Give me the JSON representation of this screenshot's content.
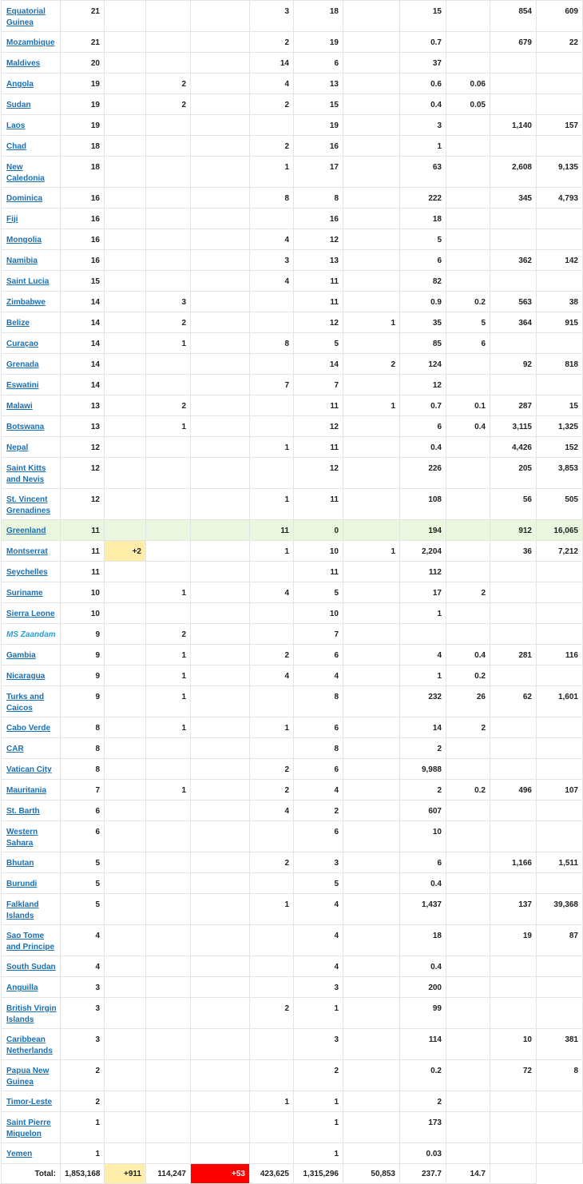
{
  "rows": [
    {
      "name": "Equatorial Guinea",
      "c": [
        "21",
        "",
        "",
        "3",
        "18",
        "",
        "15",
        "",
        "854",
        "609"
      ]
    },
    {
      "name": "Mozambique",
      "c": [
        "21",
        "",
        "",
        "2",
        "19",
        "",
        "0.7",
        "",
        "679",
        "22"
      ]
    },
    {
      "name": "Maldives",
      "c": [
        "20",
        "",
        "",
        "14",
        "6",
        "",
        "37",
        "",
        "",
        ""
      ]
    },
    {
      "name": "Angola",
      "c": [
        "19",
        "",
        "2",
        "4",
        "13",
        "",
        "0.6",
        "0.06",
        "",
        ""
      ]
    },
    {
      "name": "Sudan",
      "c": [
        "19",
        "",
        "2",
        "2",
        "15",
        "",
        "0.4",
        "0.05",
        "",
        ""
      ]
    },
    {
      "name": "Laos",
      "c": [
        "19",
        "",
        "",
        "",
        "19",
        "",
        "3",
        "",
        "1,140",
        "157"
      ]
    },
    {
      "name": "Chad",
      "c": [
        "18",
        "",
        "",
        "2",
        "16",
        "",
        "1",
        "",
        "",
        ""
      ]
    },
    {
      "name": "New Caledonia",
      "c": [
        "18",
        "",
        "",
        "1",
        "17",
        "",
        "63",
        "",
        "2,608",
        "9,135"
      ]
    },
    {
      "name": "Dominica",
      "c": [
        "16",
        "",
        "",
        "8",
        "8",
        "",
        "222",
        "",
        "345",
        "4,793"
      ]
    },
    {
      "name": "Fiji",
      "c": [
        "16",
        "",
        "",
        "",
        "16",
        "",
        "18",
        "",
        "",
        ""
      ]
    },
    {
      "name": "Mongolia",
      "c": [
        "16",
        "",
        "",
        "4",
        "12",
        "",
        "5",
        "",
        "",
        ""
      ]
    },
    {
      "name": "Namibia",
      "c": [
        "16",
        "",
        "",
        "3",
        "13",
        "",
        "6",
        "",
        "362",
        "142"
      ]
    },
    {
      "name": "Saint Lucia",
      "c": [
        "15",
        "",
        "",
        "4",
        "11",
        "",
        "82",
        "",
        "",
        ""
      ]
    },
    {
      "name": "Zimbabwe",
      "c": [
        "14",
        "",
        "3",
        "",
        "11",
        "",
        "0.9",
        "0.2",
        "563",
        "38"
      ]
    },
    {
      "name": "Belize",
      "c": [
        "14",
        "",
        "2",
        "",
        "12",
        "1",
        "35",
        "5",
        "364",
        "915"
      ]
    },
    {
      "name": "Curaçao",
      "c": [
        "14",
        "",
        "1",
        "8",
        "5",
        "",
        "85",
        "6",
        "",
        ""
      ]
    },
    {
      "name": "Grenada",
      "c": [
        "14",
        "",
        "",
        "",
        "14",
        "2",
        "124",
        "",
        "92",
        "818"
      ]
    },
    {
      "name": "Eswatini",
      "c": [
        "14",
        "",
        "",
        "7",
        "7",
        "",
        "12",
        "",
        "",
        ""
      ]
    },
    {
      "name": "Malawi",
      "c": [
        "13",
        "",
        "2",
        "",
        "11",
        "1",
        "0.7",
        "0.1",
        "287",
        "15"
      ]
    },
    {
      "name": "Botswana",
      "c": [
        "13",
        "",
        "1",
        "",
        "12",
        "",
        "6",
        "0.4",
        "3,115",
        "1,325"
      ]
    },
    {
      "name": "Nepal",
      "c": [
        "12",
        "",
        "",
        "1",
        "11",
        "",
        "0.4",
        "",
        "4,426",
        "152"
      ]
    },
    {
      "name": "Saint Kitts and Nevis",
      "c": [
        "12",
        "",
        "",
        "",
        "12",
        "",
        "226",
        "",
        "205",
        "3,853"
      ]
    },
    {
      "name": "St. Vincent Grenadines",
      "c": [
        "12",
        "",
        "",
        "1",
        "11",
        "",
        "108",
        "",
        "56",
        "505"
      ]
    },
    {
      "name": "Greenland",
      "c": [
        "11",
        "",
        "",
        "11",
        "0",
        "",
        "194",
        "",
        "912",
        "16,065"
      ]
    },
    {
      "name": "Montserrat",
      "c": [
        "11",
        "+2",
        "",
        "1",
        "10",
        "1",
        "2,204",
        "",
        "36",
        "7,212"
      ]
    },
    {
      "name": "Seychelles",
      "c": [
        "11",
        "",
        "",
        "",
        "11",
        "",
        "112",
        "",
        "",
        ""
      ]
    },
    {
      "name": "Suriname",
      "c": [
        "10",
        "",
        "1",
        "4",
        "5",
        "",
        "17",
        "2",
        "",
        ""
      ]
    },
    {
      "name": "Sierra Leone",
      "c": [
        "10",
        "",
        "",
        "",
        "10",
        "",
        "1",
        "",
        "",
        ""
      ]
    },
    {
      "name": "MS Zaandam",
      "c": [
        "9",
        "",
        "2",
        "",
        "7",
        "",
        "",
        "",
        "",
        ""
      ]
    },
    {
      "name": "Gambia",
      "c": [
        "9",
        "",
        "1",
        "2",
        "6",
        "",
        "4",
        "0.4",
        "281",
        "116"
      ]
    },
    {
      "name": "Nicaragua",
      "c": [
        "9",
        "",
        "1",
        "4",
        "4",
        "",
        "1",
        "0.2",
        "",
        ""
      ]
    },
    {
      "name": "Turks and Caicos",
      "c": [
        "9",
        "",
        "1",
        "",
        "8",
        "",
        "232",
        "26",
        "62",
        "1,601"
      ]
    },
    {
      "name": "Cabo Verde",
      "c": [
        "8",
        "",
        "1",
        "1",
        "6",
        "",
        "14",
        "2",
        "",
        ""
      ]
    },
    {
      "name": "CAR",
      "c": [
        "8",
        "",
        "",
        "",
        "8",
        "",
        "2",
        "",
        "",
        ""
      ]
    },
    {
      "name": "Vatican City",
      "c": [
        "8",
        "",
        "",
        "2",
        "6",
        "",
        "9,988",
        "",
        "",
        ""
      ]
    },
    {
      "name": "Mauritania",
      "c": [
        "7",
        "",
        "1",
        "2",
        "4",
        "",
        "2",
        "0.2",
        "496",
        "107"
      ]
    },
    {
      "name": "St. Barth",
      "c": [
        "6",
        "",
        "",
        "4",
        "2",
        "",
        "607",
        "",
        "",
        ""
      ]
    },
    {
      "name": "Western Sahara",
      "c": [
        "6",
        "",
        "",
        "",
        "6",
        "",
        "10",
        "",
        "",
        ""
      ]
    },
    {
      "name": "Bhutan",
      "c": [
        "5",
        "",
        "",
        "2",
        "3",
        "",
        "6",
        "",
        "1,166",
        "1,511"
      ]
    },
    {
      "name": "Burundi",
      "c": [
        "5",
        "",
        "",
        "",
        "5",
        "",
        "0.4",
        "",
        "",
        ""
      ]
    },
    {
      "name": "Falkland Islands",
      "c": [
        "5",
        "",
        "",
        "1",
        "4",
        "",
        "1,437",
        "",
        "137",
        "39,368"
      ]
    },
    {
      "name": "Sao Tome and Principe",
      "c": [
        "4",
        "",
        "",
        "",
        "4",
        "",
        "18",
        "",
        "19",
        "87"
      ]
    },
    {
      "name": "South Sudan",
      "c": [
        "4",
        "",
        "",
        "",
        "4",
        "",
        "0.4",
        "",
        "",
        ""
      ]
    },
    {
      "name": "Anguilla",
      "c": [
        "3",
        "",
        "",
        "",
        "3",
        "",
        "200",
        "",
        "",
        ""
      ]
    },
    {
      "name": "British Virgin Islands",
      "c": [
        "3",
        "",
        "",
        "2",
        "1",
        "",
        "99",
        "",
        "",
        ""
      ]
    },
    {
      "name": "Caribbean Netherlands",
      "c": [
        "3",
        "",
        "",
        "",
        "3",
        "",
        "114",
        "",
        "10",
        "381"
      ]
    },
    {
      "name": "Papua New Guinea",
      "c": [
        "2",
        "",
        "",
        "",
        "2",
        "",
        "0.2",
        "",
        "72",
        "8"
      ]
    },
    {
      "name": "Timor-Leste",
      "c": [
        "2",
        "",
        "",
        "1",
        "1",
        "",
        "2",
        "",
        "",
        ""
      ]
    },
    {
      "name": "Saint Pierre Miquelon",
      "c": [
        "1",
        "",
        "",
        "",
        "1",
        "",
        "173",
        "",
        "",
        ""
      ]
    },
    {
      "name": "Yemen",
      "c": [
        "1",
        "",
        "",
        "",
        "1",
        "",
        "0.03",
        "",
        "",
        ""
      ]
    }
  ],
  "total": {
    "label": "Total:",
    "c": [
      "1,853,168",
      "+911",
      "114,247",
      "+53",
      "423,625",
      "1,315,296",
      "50,853",
      "237.7",
      "14.7",
      "",
      ""
    ]
  },
  "colors": {
    "link": "#1a6fb3",
    "ship": "#23a0d0",
    "highlight_row": "#eaf6de",
    "new_cases": "#ffeeaa",
    "new_deaths": "#ff0000"
  }
}
